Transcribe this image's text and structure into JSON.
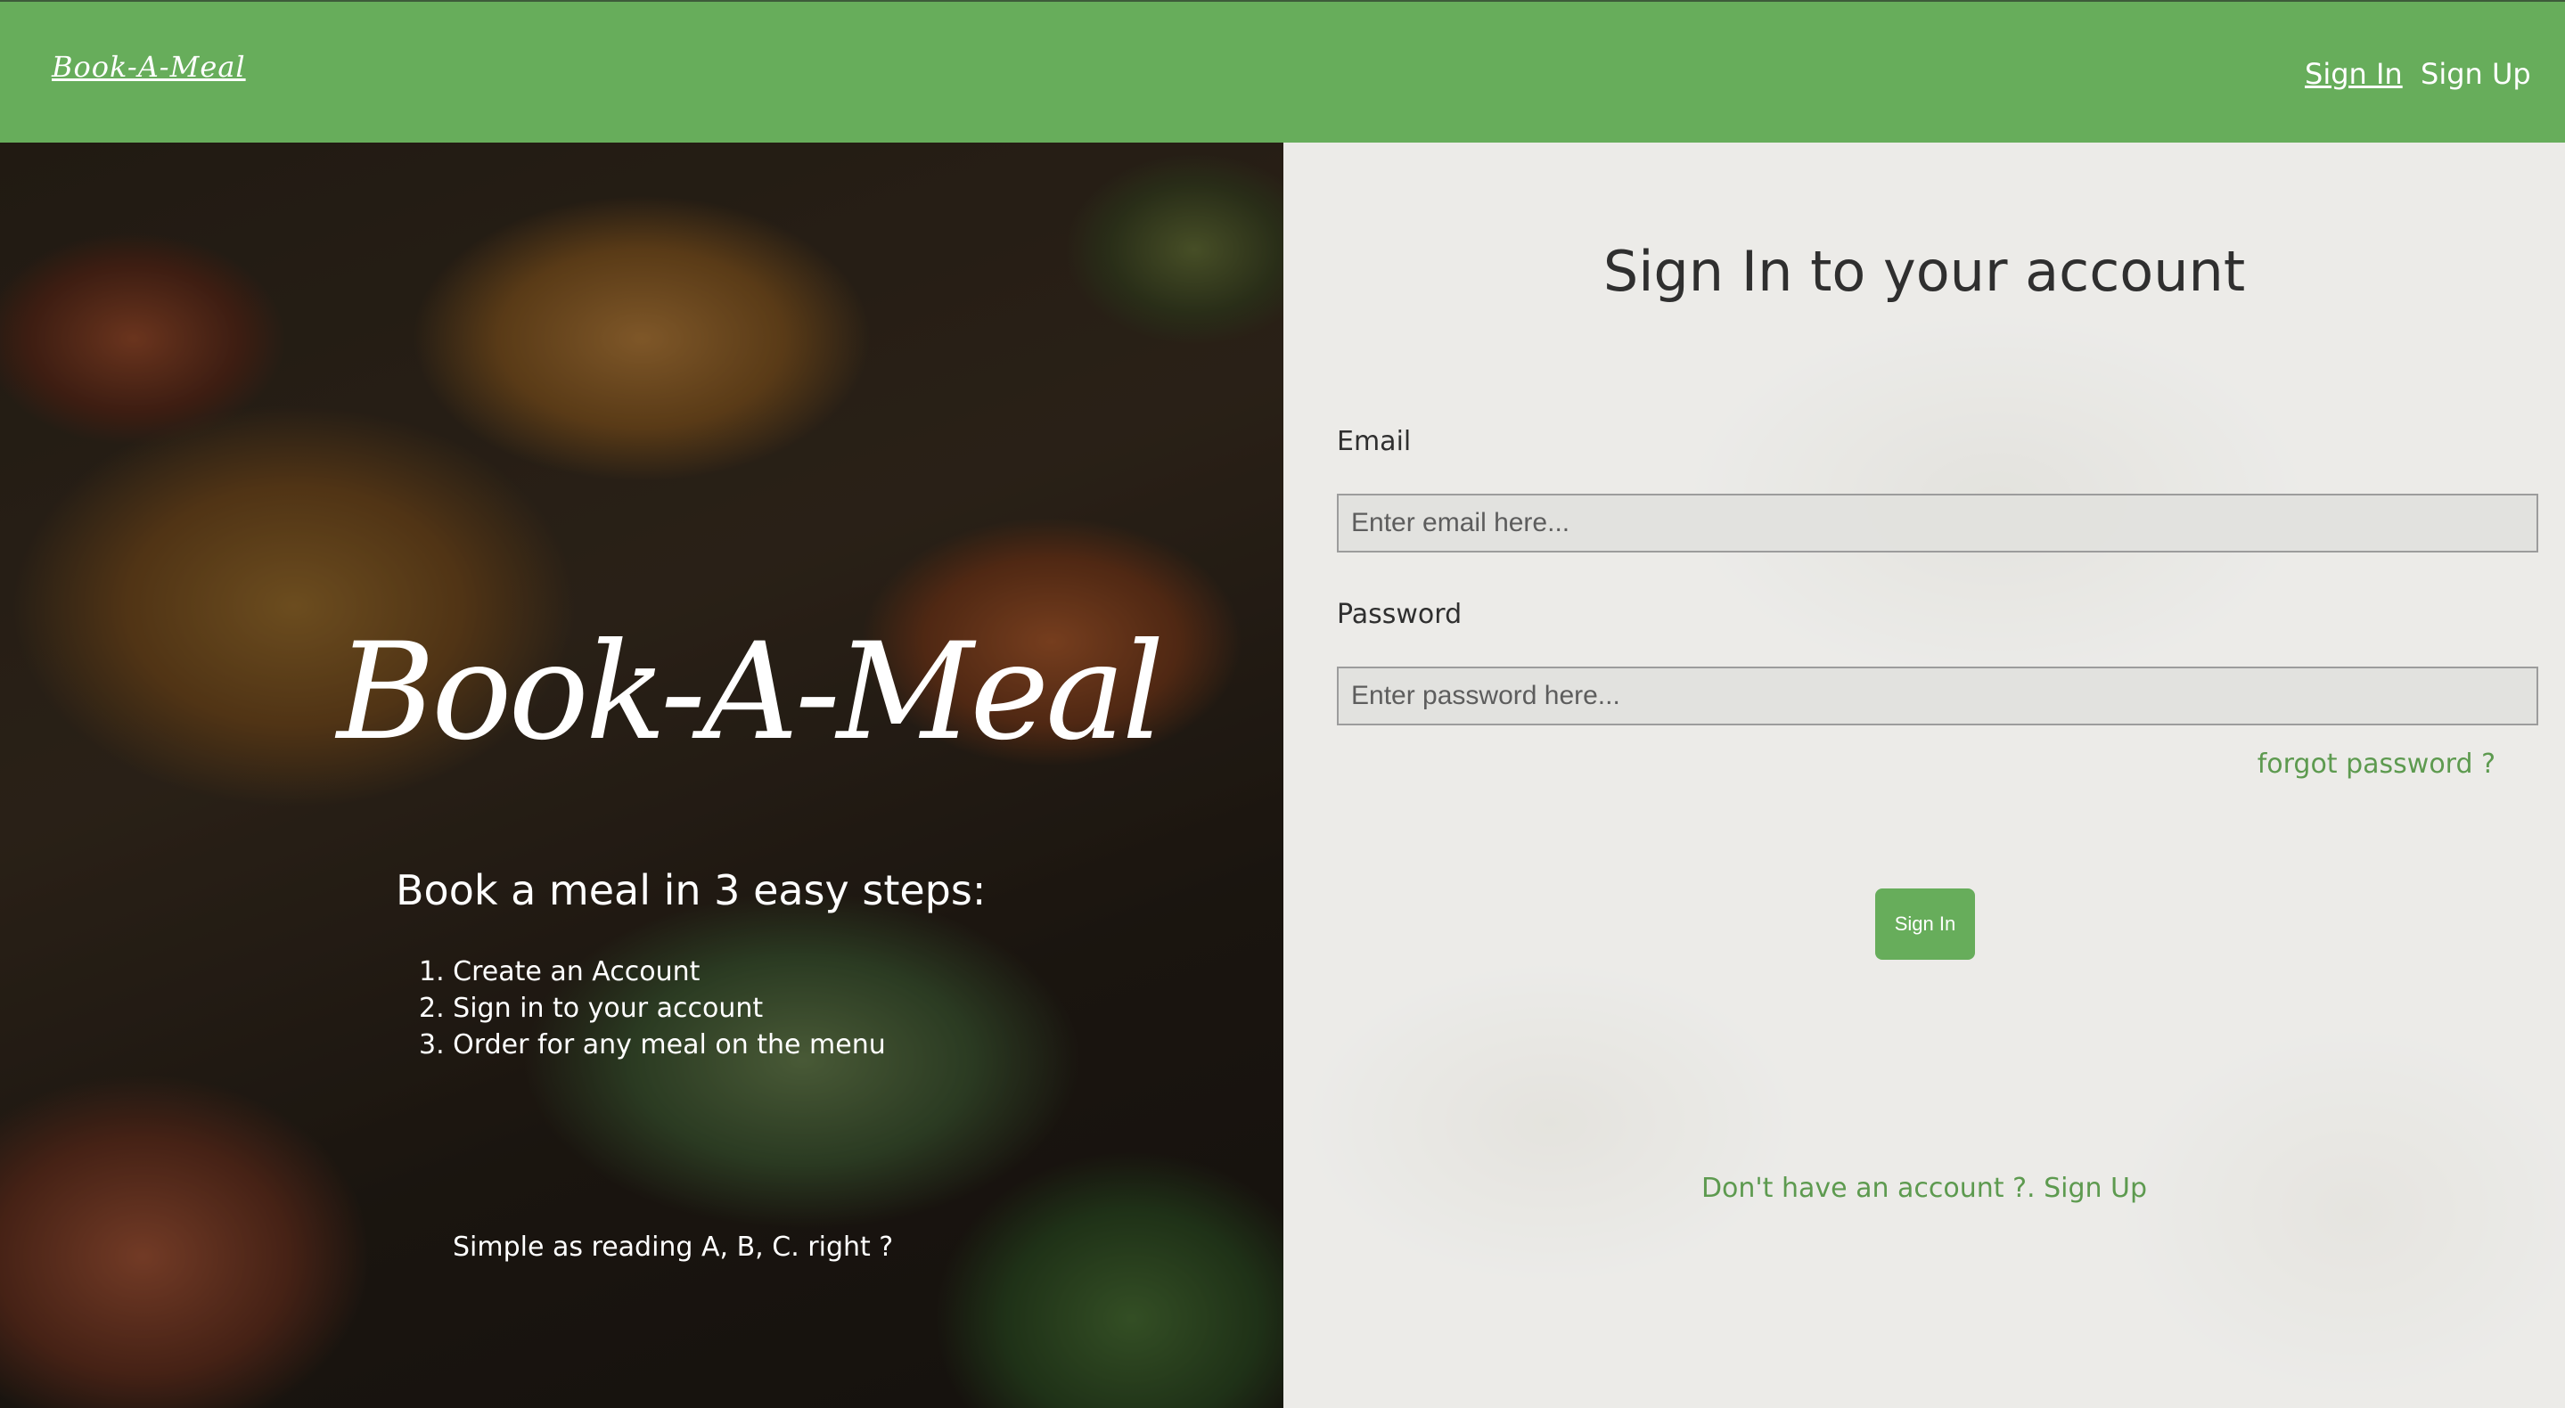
{
  "navbar": {
    "brand": "Book-A-Meal",
    "signin_label": "Sign In",
    "signup_label": "Sign Up",
    "color": "#67ad5b"
  },
  "hero": {
    "title": "Book-A-Meal",
    "subtitle": "Book a meal in 3 easy steps:",
    "steps": [
      "1. Create an Account",
      "2. Sign in to your account",
      "3. Order for any meal on the menu"
    ],
    "note": "Simple as reading A, B, C. right ?"
  },
  "form": {
    "title": "Sign In to your account",
    "email_label": "Email",
    "email_placeholder": "Enter email here...",
    "password_label": "Password",
    "password_placeholder": "Enter password here...",
    "forgot_label": "forgot password ?",
    "submit_label": "Sign In",
    "signup_prompt": "Don't have an account ?. Sign Up",
    "accent_color": "#5d9a4f"
  }
}
